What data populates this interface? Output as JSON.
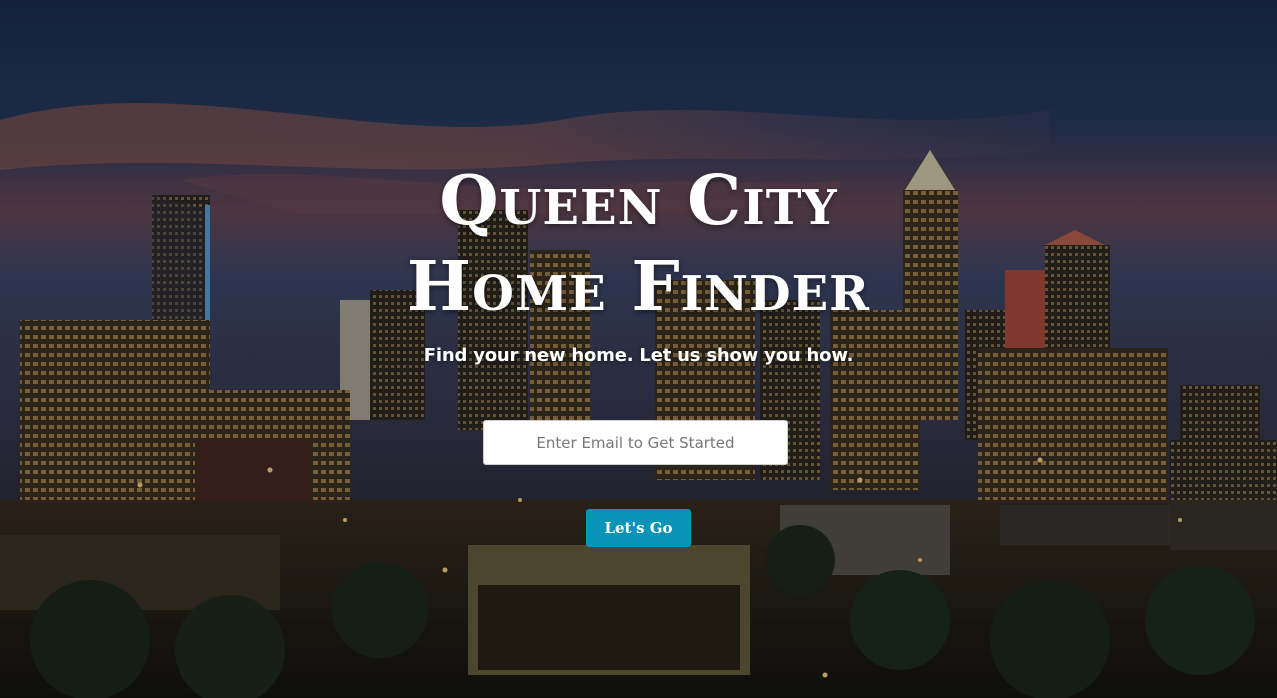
{
  "hero": {
    "title_line1": "Queen City",
    "title_line2": "Home Finder",
    "subtitle": "Find your new home. Let us show you how."
  },
  "form": {
    "email_placeholder": "Enter Email to Get Started",
    "email_value": "",
    "submit_label": "Let's Go"
  },
  "colors": {
    "button": "#0a93b8",
    "text": "#ffffff",
    "sky_top": "#1b2d4e"
  }
}
